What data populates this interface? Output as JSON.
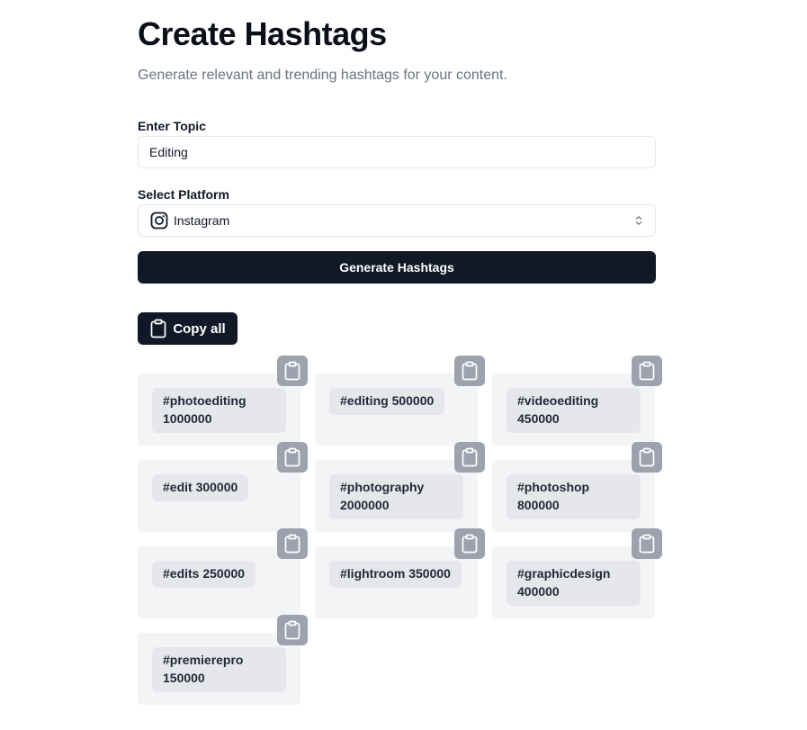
{
  "header": {
    "title": "Create Hashtags",
    "subtitle": "Generate relevant and trending hashtags for your content."
  },
  "form": {
    "topic_label": "Enter Topic",
    "topic_value": "Editing",
    "platform_label": "Select Platform",
    "platform_value": "Instagram",
    "platform_icon": "instagram-icon",
    "generate_label": "Generate Hashtags"
  },
  "results": {
    "copy_all_label": "Copy all",
    "copy_icon": "clipboard-icon",
    "hashtags": [
      {
        "tag": "#photoediting",
        "count": "1000000"
      },
      {
        "tag": "#editing",
        "count": "500000"
      },
      {
        "tag": "#videoediting",
        "count": "450000"
      },
      {
        "tag": "#edit",
        "count": "300000"
      },
      {
        "tag": "#photography",
        "count": "2000000"
      },
      {
        "tag": "#photoshop",
        "count": "800000"
      },
      {
        "tag": "#edits",
        "count": "250000"
      },
      {
        "tag": "#lightroom",
        "count": "350000"
      },
      {
        "tag": "#graphicdesign",
        "count": "400000"
      },
      {
        "tag": "#premierepro",
        "count": "150000"
      }
    ]
  },
  "colors": {
    "primary": "#111827",
    "card_bg": "#f3f4f6",
    "chip_bg": "#e5e7eb",
    "copy_button_bg": "#9ca3af",
    "muted_text": "#6b7280"
  }
}
